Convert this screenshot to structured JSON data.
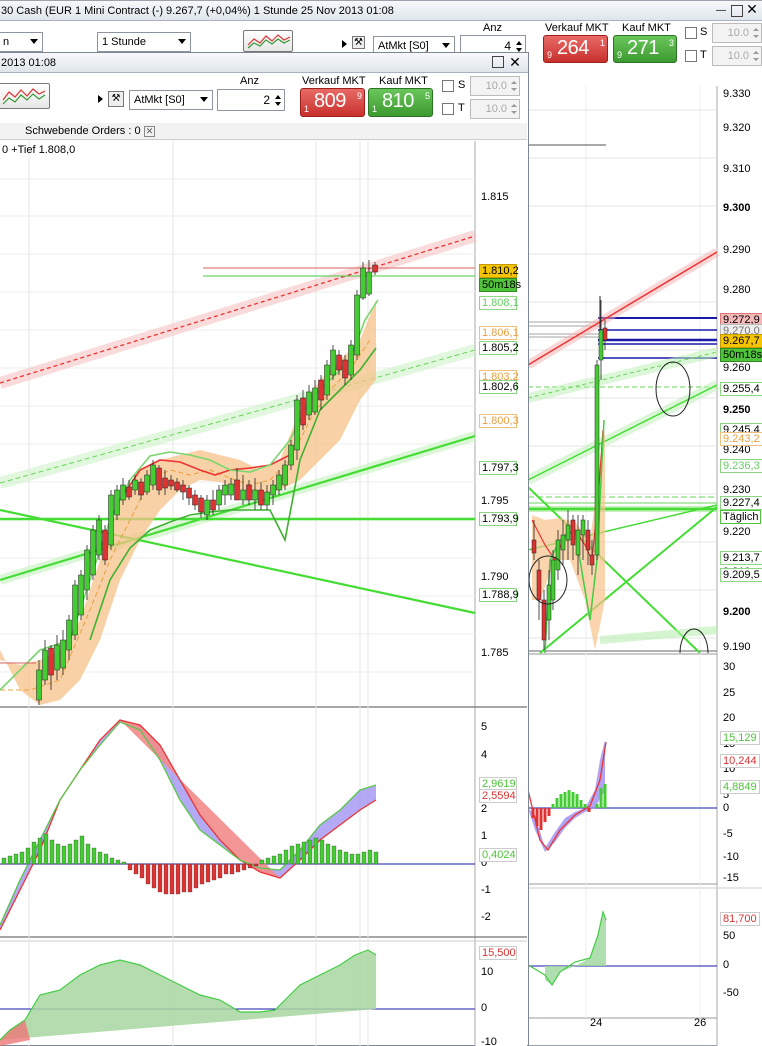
{
  "back_window": {
    "title": "30 Cash (EUR 1 Mini Contract (-)     9.267,7 (+0,04%)     1 Stunde   25 Nov 2013 01:08",
    "dropdown_left": "n",
    "dropdown_period": "1 Stunde",
    "anz_label": "Anz",
    "anz_value": "4",
    "atmkt_label": "AtMkt [S0]",
    "sell_label": "Verkauf MKT",
    "buy_label": "Kauf MKT",
    "sell_pre": "9",
    "sell_big": "264",
    "sell_suf": "1",
    "buy_pre": "9",
    "buy_big": "271",
    "buy_suf": "3",
    "s_label": "S",
    "t_label": "T",
    "s_value": "10.0",
    "t_value": "10.0",
    "price_ticks": [
      "9.330",
      "9.320",
      "9.310",
      "9.300",
      "9.290",
      "9.280",
      "9.270",
      "9.260",
      "9.250",
      "9.240",
      "9.230",
      "9.220",
      "9.210",
      "9.200",
      "9.190"
    ],
    "price_tags": [
      {
        "text": "9.272,9",
        "bg": "#f3b8b8",
        "fg": "#000",
        "bd": "#d77"
      },
      {
        "text": "9.270,0",
        "bg": "#eeeeee",
        "fg": "#777",
        "bd": "#bbb"
      },
      {
        "text": "9.267,7",
        "bg": "#f5c400",
        "fg": "#000",
        "bd": "#c49a00"
      },
      {
        "text": "50m18s",
        "bg": "#4fc43a",
        "fg": "#000",
        "bd": "#2f8a1f"
      },
      {
        "text": "9.255,4",
        "bg": "#ffffff",
        "fg": "#000",
        "bd": "#8bd680"
      },
      {
        "text": "9.245,4",
        "bg": "#ffffff",
        "fg": "#000",
        "bd": "#8bd680"
      },
      {
        "text": "9.243,2",
        "bg": "#ffffff",
        "fg": "#e8a040",
        "bd": "#f0c080"
      },
      {
        "text": "9.236,3",
        "bg": "#ffffff",
        "fg": "#6c6",
        "bd": "#8bd680"
      },
      {
        "text": "9.227,4",
        "bg": "#ffffff",
        "fg": "#000",
        "bd": "#8bd680"
      },
      {
        "text": "Täglich",
        "bg": "#ffffff",
        "fg": "#000",
        "bd": "#4fc43a"
      },
      {
        "text": "9.213,7",
        "bg": "#ffffff",
        "fg": "#000",
        "bd": "#8bd680"
      },
      {
        "text": "9.209,5",
        "bg": "#ffffff",
        "fg": "#000",
        "bd": "#8bd680"
      }
    ],
    "macd_ticks": [
      "30",
      "25",
      "20",
      "15",
      "10",
      "5",
      "0",
      "-5",
      "-10",
      "-15"
    ],
    "macd_tags": [
      {
        "text": "15,129",
        "fg": "#4fc43a"
      },
      {
        "text": "10,244",
        "fg": "#d33"
      },
      {
        "text": "4,8849",
        "fg": "#4fc43a"
      }
    ],
    "osc_ticks": [
      "50",
      "0",
      "-50"
    ],
    "osc_tag": "81,700",
    "x_ticks": [
      "24",
      "26"
    ]
  },
  "front_window": {
    "title": "2013 01:08",
    "anz_label": "Anz",
    "anz_value": "2",
    "atmkt_label": "AtMkt [S0]",
    "sell_label": "Verkauf MKT",
    "buy_label": "Kauf MKT",
    "sell_pre": "1",
    "sell_big": "809",
    "sell_suf": "9",
    "buy_pre": "1",
    "buy_big": "810",
    "buy_suf": "5",
    "s_label": "S",
    "t_label": "T",
    "s_value": "10.0",
    "t_value": "10.0",
    "pending_orders": "Schwebende Orders : 0",
    "info_text": "0 +Tief 1.808,0",
    "price_ticks": [
      "1.815",
      "1.810",
      "1.805",
      "1.800",
      "1.795",
      "1.790",
      "1.785"
    ],
    "price_tags": [
      {
        "text": "1.810,2",
        "bg": "#f5c400",
        "fg": "#000",
        "bd": "#c49a00"
      },
      {
        "text": "50m18s",
        "bg": "#4fc43a",
        "fg": "#000",
        "bd": "#2f8a1f"
      },
      {
        "text": "1.808,1",
        "bg": "#ffffff",
        "fg": "#6c6",
        "bd": "#8bd680"
      },
      {
        "text": "1.806,1",
        "bg": "#ffffff",
        "fg": "#e8a040",
        "bd": "#f0c080"
      },
      {
        "text": "1.805,2",
        "bg": "#ffffff",
        "fg": "#000",
        "bd": "#8bd680"
      },
      {
        "text": "1.803,2",
        "bg": "#ffffff",
        "fg": "#e8a040",
        "bd": "#f0c080"
      },
      {
        "text": "1.802,6",
        "bg": "#ffffff",
        "fg": "#000",
        "bd": "#8bd680"
      },
      {
        "text": "1.800,3",
        "bg": "#ffffff",
        "fg": "#e8a040",
        "bd": "#f0c080"
      },
      {
        "text": "1.797,3",
        "bg": "#ffffff",
        "fg": "#000",
        "bd": "#8bd680"
      },
      {
        "text": "1.793,9",
        "bg": "#ffffff",
        "fg": "#000",
        "bd": "#8bd680"
      },
      {
        "text": "1.788,9",
        "bg": "#ffffff",
        "fg": "#000",
        "bd": "#8bd680"
      }
    ],
    "macd_ticks": [
      "5",
      "4",
      "3",
      "2",
      "1",
      "0",
      "-1",
      "-2"
    ],
    "macd_tags": [
      {
        "text": "2,9619",
        "fg": "#4fc43a"
      },
      {
        "text": "2,5594",
        "fg": "#d33"
      },
      {
        "text": "0,4024",
        "fg": "#4fc43a"
      }
    ],
    "osc_ticks": [
      "15,500",
      "10",
      "0",
      "-10"
    ]
  },
  "colors": {
    "bull": "#44cc33",
    "bear": "#dd3333",
    "band": "#f7c28a",
    "trend_green": "#44dd33",
    "trend_red": "#e33"
  },
  "icons": {
    "chart_type": "candlestick-chart-icon",
    "tools": "wrench-icon",
    "play": "play-triangle-icon",
    "close": "close-icon",
    "maximize": "maximize-icon",
    "minimize": "minimize-icon"
  }
}
